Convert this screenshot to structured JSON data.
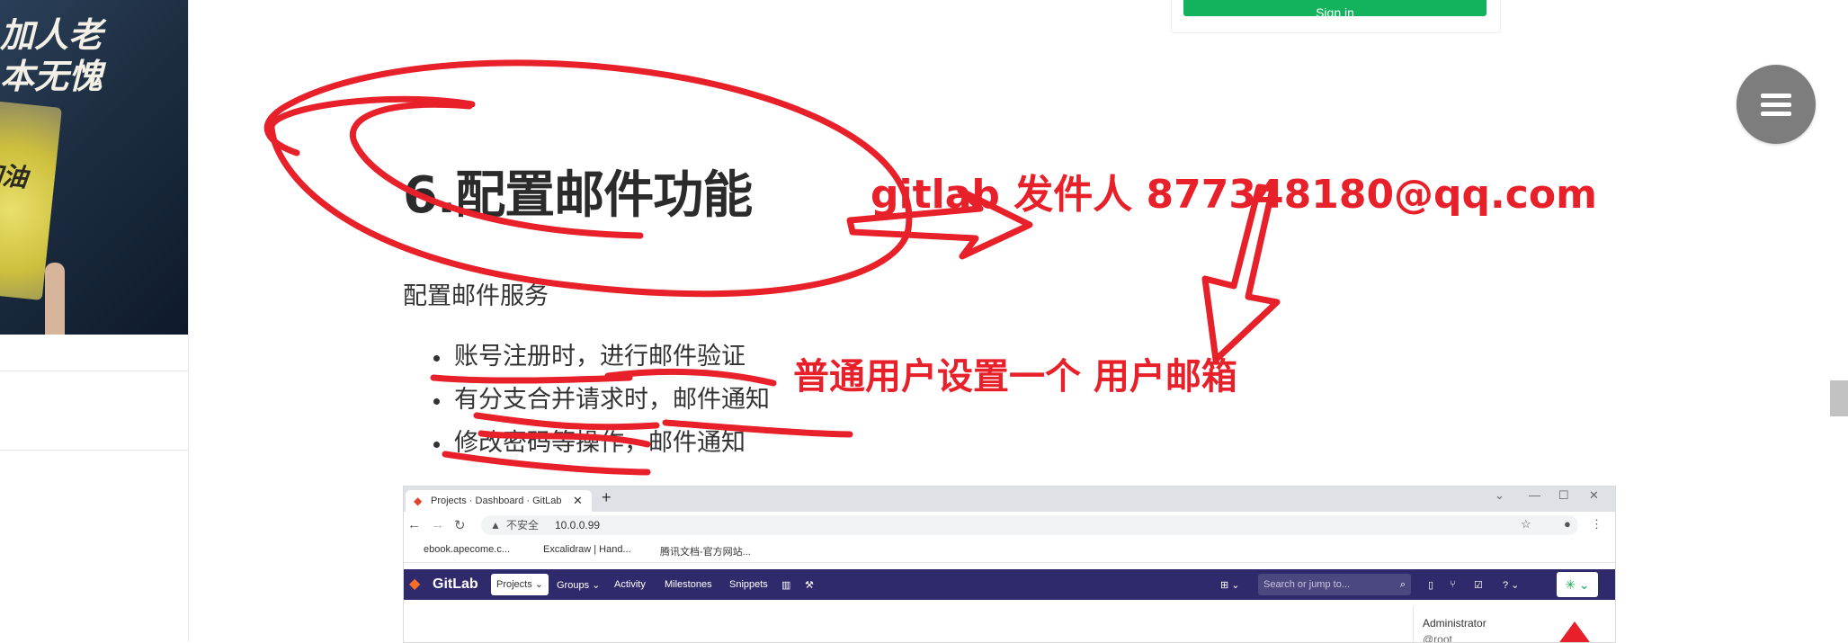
{
  "signin": {
    "label": "Sign in"
  },
  "sidebar": {
    "banner_text_line1": "加人老",
    "banner_text_line2": "本无愧",
    "banner_sign": "加油"
  },
  "article": {
    "heading": "6.配置邮件功能",
    "intro": "配置邮件服务",
    "bullets": [
      "账号注册时，进行邮件验证",
      "有分支合并请求时，邮件通知",
      "修改密码等操作，邮件通知"
    ]
  },
  "annotations": {
    "sender_note": "gitlab  发件人 877348180@qq.com",
    "user_note": "普通用户设置一个 用户邮箱"
  },
  "screenshot": {
    "tab_title": "Projects · Dashboard · GitLab",
    "url_warning": "不安全",
    "url": "10.0.0.99",
    "bookmarks": [
      "ebook.apecome.c...",
      "Excalidraw | Hand...",
      "腾讯文档-官方网站..."
    ],
    "brand": "GitLab",
    "nav": {
      "projects": "Projects",
      "groups": "Groups",
      "activity": "Activity",
      "milestones": "Milestones",
      "snippets": "Snippets"
    },
    "search_placeholder": "Search or jump to...",
    "dropdown_name": "Administrator",
    "dropdown_handle": "@root"
  },
  "colors": {
    "accent_red": "#e8202a",
    "signin_green": "#13b35e",
    "gitlab_nav": "#2f2a6b"
  },
  "icons": [
    "menu-icon",
    "gitlab-logo-icon",
    "search-icon",
    "reload-icon",
    "back-icon",
    "forward-icon",
    "star-icon"
  ]
}
